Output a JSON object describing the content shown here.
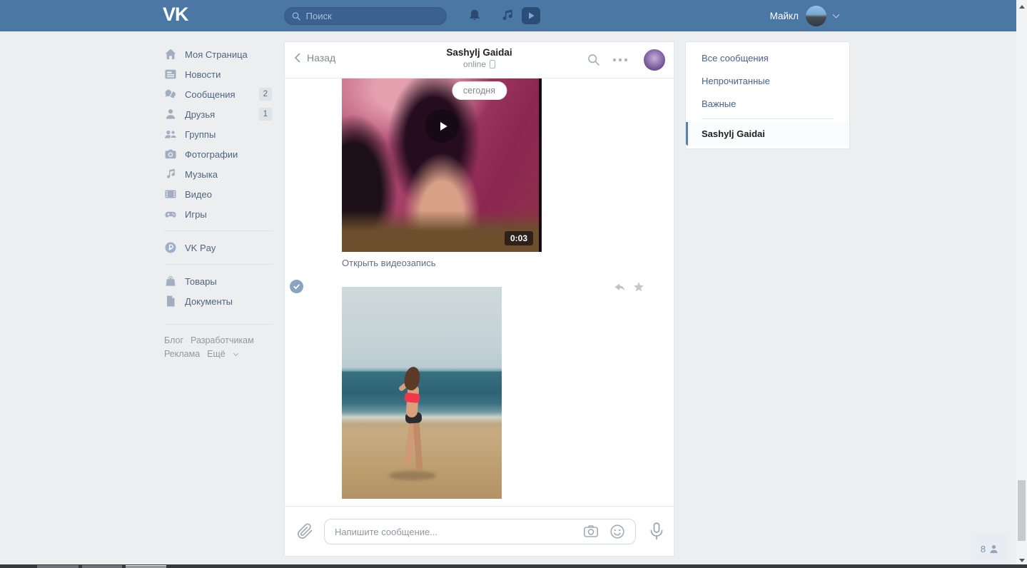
{
  "topbar": {
    "logo": "VK",
    "search_placeholder": "Поиск",
    "user_name": "Майкл"
  },
  "sidebar": {
    "items": [
      {
        "label": "Моя Страница",
        "icon": "home-icon",
        "badge": ""
      },
      {
        "label": "Новости",
        "icon": "news-icon",
        "badge": ""
      },
      {
        "label": "Сообщения",
        "icon": "messages-icon",
        "badge": "2"
      },
      {
        "label": "Друзья",
        "icon": "friends-icon",
        "badge": "1"
      },
      {
        "label": "Группы",
        "icon": "groups-icon",
        "badge": ""
      },
      {
        "label": "Фотографии",
        "icon": "photos-icon",
        "badge": ""
      },
      {
        "label": "Музыка",
        "icon": "music-icon",
        "badge": ""
      },
      {
        "label": "Видео",
        "icon": "video-icon",
        "badge": ""
      },
      {
        "label": "Игры",
        "icon": "games-icon",
        "badge": ""
      },
      {
        "label": "VK Pay",
        "icon": "vkpay-icon",
        "badge": ""
      },
      {
        "label": "Товары",
        "icon": "market-icon",
        "badge": ""
      },
      {
        "label": "Документы",
        "icon": "docs-icon",
        "badge": ""
      }
    ],
    "footer_links": [
      "Блог",
      "Разработчикам",
      "Реклама",
      "Ещё"
    ]
  },
  "chat": {
    "back_label": "Назад",
    "title": "Sashylj Gaidai",
    "status": "online",
    "date_badge": "сегодня",
    "video_duration": "0:03",
    "video_link_label": "Открыть видеозапись",
    "input_placeholder": "Напишите сообщение..."
  },
  "right_panel": {
    "filters": [
      "Все сообщения",
      "Непрочитанные",
      "Важные"
    ],
    "active_dialog": "Sashylj Gaidai"
  },
  "online_friends": {
    "count": "8"
  },
  "colors": {
    "topbar_bg": "#4a77a4",
    "page_bg": "#edeef0",
    "accent_blue": "#5b7fa6",
    "sidebar_text": "#4f6680",
    "filter_link": "#46648a",
    "badge_bg": "#dce3e9",
    "bikini_red": "#f2384f"
  }
}
